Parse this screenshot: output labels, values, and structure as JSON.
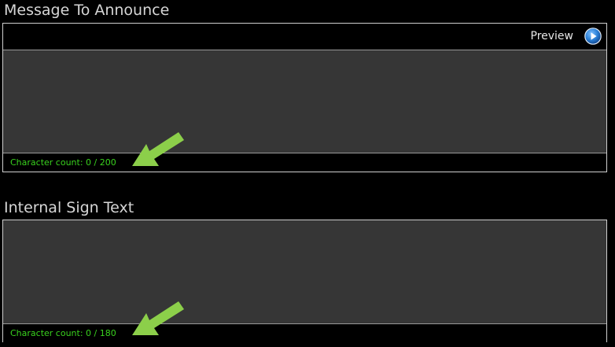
{
  "announce": {
    "title": "Message To Announce",
    "preview_label": "Preview",
    "preview_icon": "play-circle-icon",
    "message_value": "",
    "char_count_label": "Character count:",
    "char_count_current": 0,
    "char_count_max": 200,
    "char_count_text": "Character count: 0 / 200"
  },
  "sign": {
    "title": "Internal Sign Text",
    "message_value": "",
    "char_count_label": "Character count:",
    "char_count_current": 0,
    "char_count_max": 180,
    "char_count_text": "Character count: 0 / 180"
  },
  "annotations": {
    "arrow_icon": "arrow-pointer-icon",
    "arrow_color": "#8ccf4a"
  },
  "colors": {
    "background": "#000000",
    "textarea_bg": "#363636",
    "count_green": "#39d21e",
    "title_text": "#d6d6d6",
    "preview_blue": "#1f6fc4"
  }
}
